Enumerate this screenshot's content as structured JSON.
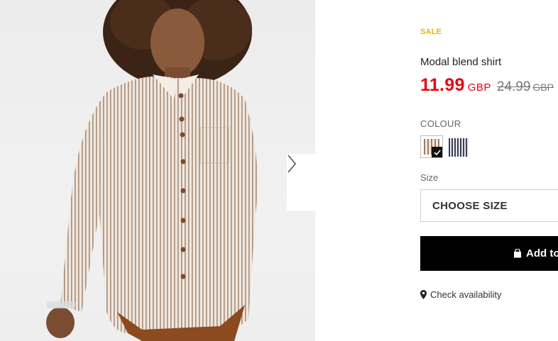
{
  "product": {
    "badge": "SALE",
    "title": "Modal blend shirt",
    "price_now": "11.99",
    "currency_now": "GBP",
    "price_old": "24.99",
    "currency_old": "GBP",
    "colors": {
      "sale": "#e6b800",
      "price": "#e30613"
    }
  },
  "colour": {
    "label": "COLOUR",
    "swatches": [
      {
        "name": "beige-stripe",
        "selected": true
      },
      {
        "name": "navy-stripe",
        "selected": false
      }
    ]
  },
  "size": {
    "label": "Size",
    "selected": "CHOOSE SIZE"
  },
  "actions": {
    "add_to_bag": "Add to",
    "check_availability": "Check availability"
  },
  "gallery": {
    "next_icon": "chevron-right-icon"
  }
}
